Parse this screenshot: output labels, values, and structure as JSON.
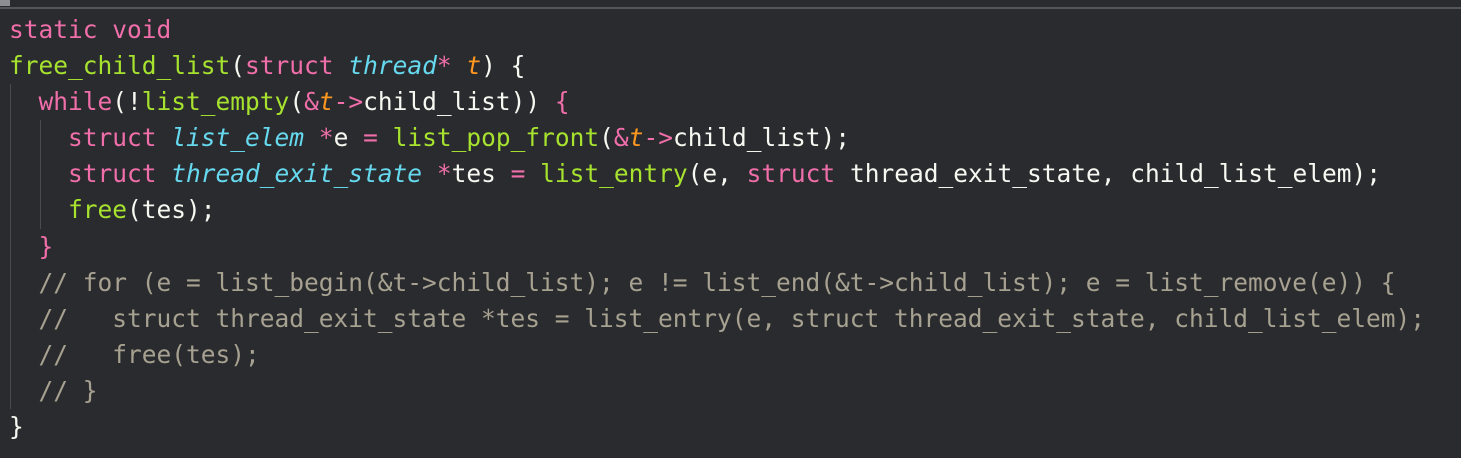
{
  "editor": {
    "lines": [
      [
        {
          "c": "kw",
          "t": "static void"
        }
      ],
      [
        {
          "c": "fn",
          "t": "free_child_list"
        },
        {
          "c": "pun",
          "t": "("
        },
        {
          "c": "kw",
          "t": "struct"
        },
        {
          "c": "pun",
          "t": " "
        },
        {
          "c": "type",
          "t": "thread"
        },
        {
          "c": "op",
          "t": "*"
        },
        {
          "c": "pun",
          "t": " "
        },
        {
          "c": "prm",
          "t": "t"
        },
        {
          "c": "pun",
          "t": ") {"
        }
      ],
      [
        {
          "c": "pun",
          "t": "  "
        },
        {
          "c": "kw",
          "t": "while"
        },
        {
          "c": "pun",
          "t": "(!"
        },
        {
          "c": "fn",
          "t": "list_empty"
        },
        {
          "c": "pun",
          "t": "("
        },
        {
          "c": "op",
          "t": "&"
        },
        {
          "c": "prm",
          "t": "t"
        },
        {
          "c": "op",
          "t": "->"
        },
        {
          "c": "pun",
          "t": "child_list)) "
        },
        {
          "c": "kw",
          "t": "{"
        }
      ],
      [
        {
          "c": "pun",
          "t": "    "
        },
        {
          "c": "kw",
          "t": "struct"
        },
        {
          "c": "pun",
          "t": " "
        },
        {
          "c": "type",
          "t": "list_elem"
        },
        {
          "c": "pun",
          "t": " "
        },
        {
          "c": "op",
          "t": "*"
        },
        {
          "c": "pun",
          "t": "e "
        },
        {
          "c": "op",
          "t": "="
        },
        {
          "c": "pun",
          "t": " "
        },
        {
          "c": "fn",
          "t": "list_pop_front"
        },
        {
          "c": "pun",
          "t": "("
        },
        {
          "c": "op",
          "t": "&"
        },
        {
          "c": "prm",
          "t": "t"
        },
        {
          "c": "op",
          "t": "->"
        },
        {
          "c": "pun",
          "t": "child_list);"
        }
      ],
      [
        {
          "c": "pun",
          "t": "    "
        },
        {
          "c": "kw",
          "t": "struct"
        },
        {
          "c": "pun",
          "t": " "
        },
        {
          "c": "type",
          "t": "thread_exit_state"
        },
        {
          "c": "pun",
          "t": " "
        },
        {
          "c": "op",
          "t": "*"
        },
        {
          "c": "pun",
          "t": "tes "
        },
        {
          "c": "op",
          "t": "="
        },
        {
          "c": "pun",
          "t": " "
        },
        {
          "c": "fn",
          "t": "list_entry"
        },
        {
          "c": "pun",
          "t": "(e, "
        },
        {
          "c": "kw",
          "t": "struct"
        },
        {
          "c": "pun",
          "t": " thread_exit_state, child_list_elem);"
        }
      ],
      [
        {
          "c": "pun",
          "t": "    "
        },
        {
          "c": "fn",
          "t": "free"
        },
        {
          "c": "pun",
          "t": "(tes);"
        }
      ],
      [
        {
          "c": "pun",
          "t": "  "
        },
        {
          "c": "kw",
          "t": "}"
        }
      ],
      [
        {
          "c": "pun",
          "t": "  "
        },
        {
          "c": "cm",
          "t": "// for (e = list_begin(&t->child_list); e != list_end(&t->child_list); e = list_remove(e)) {"
        }
      ],
      [
        {
          "c": "pun",
          "t": "  "
        },
        {
          "c": "cm",
          "t": "//   struct thread_exit_state *tes = list_entry(e, struct thread_exit_state, child_list_elem);"
        }
      ],
      [
        {
          "c": "pun",
          "t": "  "
        },
        {
          "c": "cm",
          "t": "//   free(tes);"
        }
      ],
      [
        {
          "c": "pun",
          "t": "  "
        },
        {
          "c": "cm",
          "t": "// }"
        }
      ],
      [
        {
          "c": "pun",
          "t": "}"
        }
      ]
    ]
  }
}
